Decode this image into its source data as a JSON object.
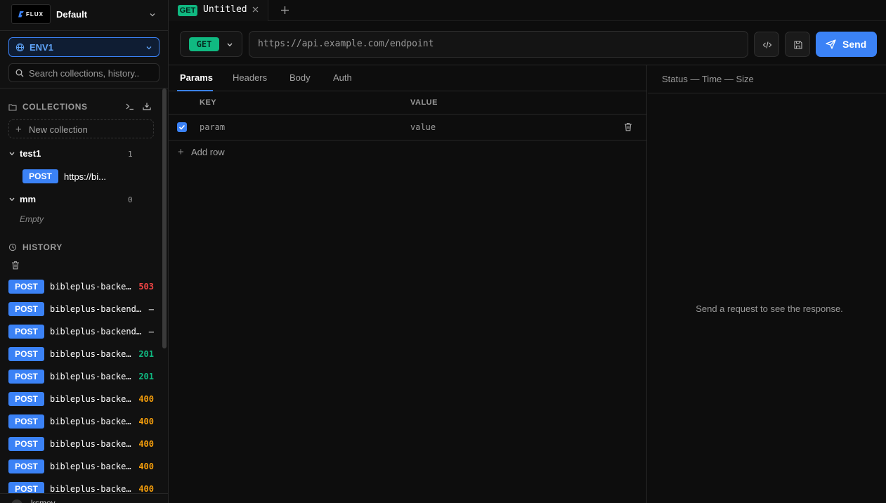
{
  "workspace": {
    "logo_text": "FLUX",
    "name": "Default"
  },
  "env": {
    "label": "ENV1"
  },
  "search": {
    "placeholder": "Search collections, history.."
  },
  "collections": {
    "title": "COLLECTIONS",
    "new_label": "New collection",
    "folders": [
      {
        "name": "test1",
        "count": "1",
        "requests": [
          {
            "method": "POST",
            "url": "https://bi..."
          }
        ]
      },
      {
        "name": "mm",
        "count": "0",
        "empty_label": "Empty"
      }
    ]
  },
  "history": {
    "title": "HISTORY",
    "items": [
      {
        "method": "POST",
        "url": "bibleplus-backend...",
        "status": "503"
      },
      {
        "method": "POST",
        "url": "bibleplus-backend...",
        "status": "—"
      },
      {
        "method": "POST",
        "url": "bibleplus-backend...",
        "status": "—"
      },
      {
        "method": "POST",
        "url": "bibleplus-backend...",
        "status": "201"
      },
      {
        "method": "POST",
        "url": "bibleplus-backend...",
        "status": "201"
      },
      {
        "method": "POST",
        "url": "bibleplus-backend...",
        "status": "400"
      },
      {
        "method": "POST",
        "url": "bibleplus-backend...",
        "status": "400"
      },
      {
        "method": "POST",
        "url": "bibleplus-backend...",
        "status": "400"
      },
      {
        "method": "POST",
        "url": "bibleplus-backend...",
        "status": "400"
      },
      {
        "method": "POST",
        "url": "bibleplus-backend...",
        "status": "400"
      }
    ],
    "bottom_user": "ksmey"
  },
  "tabs": [
    {
      "method": "GET",
      "title": "Untitled"
    }
  ],
  "request": {
    "method": "GET",
    "url_placeholder": "https://api.example.com/endpoint",
    "send_label": "Send",
    "tabs": [
      "Params",
      "Headers",
      "Body",
      "Auth"
    ],
    "active_tab": "Params",
    "params": {
      "header_key": "KEY",
      "header_value": "VALUE",
      "rows": [
        {
          "key": "param",
          "value": "value",
          "enabled": true
        }
      ],
      "add_label": "Add row"
    }
  },
  "response": {
    "meta": "Status — Time — Size",
    "empty": "Send a request to see the response."
  },
  "colors": {
    "accent": "#3b82f6",
    "get": "#10b981",
    "status_5xx": "#ef4444",
    "status_2xx": "#10b981",
    "status_4xx": "#f59e0b",
    "status_none": "#a3a3a3"
  }
}
